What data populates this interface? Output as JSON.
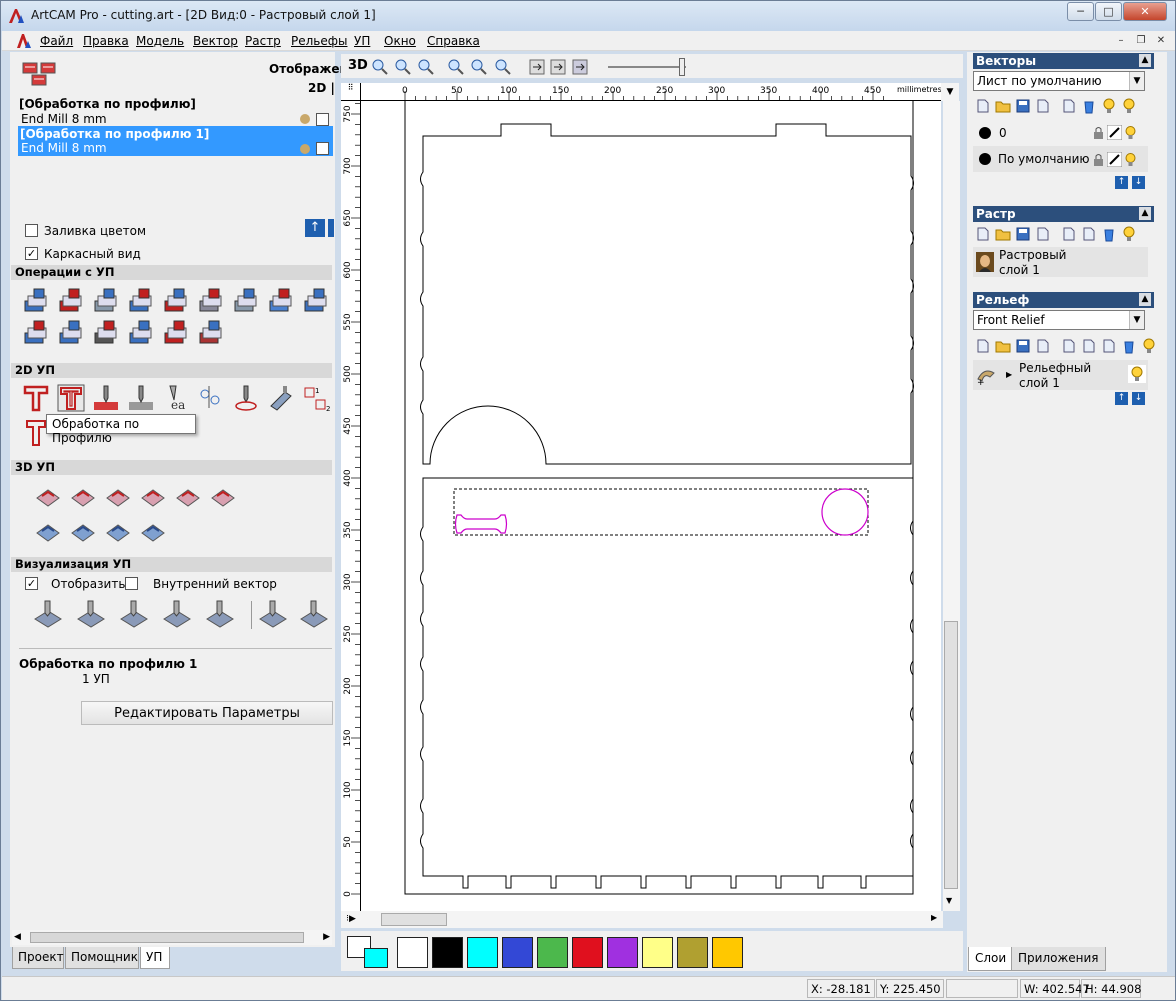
{
  "window": {
    "title": "ArtCAM Pro - cutting.art - [2D Вид:0 - Растровый слой 1]",
    "controls": {
      "minimize": "─",
      "maximize": "□",
      "close": "✕"
    }
  },
  "menu": {
    "items": [
      "Файл",
      "Правка",
      "Модель",
      "Вектор",
      "Растр",
      "Рельефы",
      "УП",
      "Окно",
      "Справка"
    ],
    "mdi": {
      "minimize": "–",
      "restore": "❐",
      "close": "✕"
    }
  },
  "left": {
    "display_label": "Отображен",
    "display_2d": "2D |",
    "toolpaths": [
      {
        "name": "[Обработка по профилю]",
        "tool": "End Mill 8 mm",
        "selected": false
      },
      {
        "name": "[Обработка по профилю 1]",
        "tool": "End Mill 8 mm",
        "selected": true
      }
    ],
    "fill_color_label": "Заливка цветом",
    "wireframe_label": "Каркасный вид",
    "sections": {
      "ops": "Операции с УП",
      "toolpath2d": "2D УП",
      "toolpath3d": "3D УП",
      "vis": "Визуализация УП"
    },
    "tooltip": "Обработка по Профилю",
    "show_label": "Отобразить",
    "inner_vector_label": "Внутренний вектор",
    "summary_title": "Обработка по профилю 1",
    "summary_count": "1 УП",
    "edit_button": "Редактировать Параметры",
    "tabs": [
      "Проект",
      "Помощник",
      "УП"
    ]
  },
  "view": {
    "mode_label": "3D",
    "ruler_unit": "millimetres",
    "ruler_h": [
      "0",
      "50",
      "100",
      "150",
      "200",
      "250",
      "300",
      "350",
      "400",
      "450"
    ],
    "ruler_v": [
      "750",
      "700",
      "650",
      "600",
      "550",
      "500",
      "450",
      "400",
      "350",
      "300",
      "250",
      "200",
      "150",
      "100",
      "50",
      "0"
    ],
    "zoom_slider": 0.95
  },
  "palette": {
    "colors": [
      "#ffffff",
      "#000000",
      "#00ffff",
      "#3348d6",
      "#4cb84c",
      "#e0101e",
      "#a030e0",
      "#ffff88",
      "#b0a030",
      "#ffc800"
    ]
  },
  "right": {
    "vectors": {
      "title": "Векторы",
      "sheet": "Лист по умолчанию",
      "layers": [
        {
          "name": "0"
        },
        {
          "name": "По умолчанию"
        }
      ]
    },
    "raster": {
      "title": "Растр",
      "layer_line1": "Растровый",
      "layer_line2": "слой 1"
    },
    "relief": {
      "title": "Рельеф",
      "combo": "Front Relief",
      "layer_line1": "Рельефный",
      "layer_line2": "слой 1"
    },
    "tabs": [
      "Слои",
      "Приложения"
    ]
  },
  "status": {
    "x": "X: -28.181",
    "y": "Y: 225.450",
    "w": "W: 402.547",
    "h": "H: 44.908"
  }
}
